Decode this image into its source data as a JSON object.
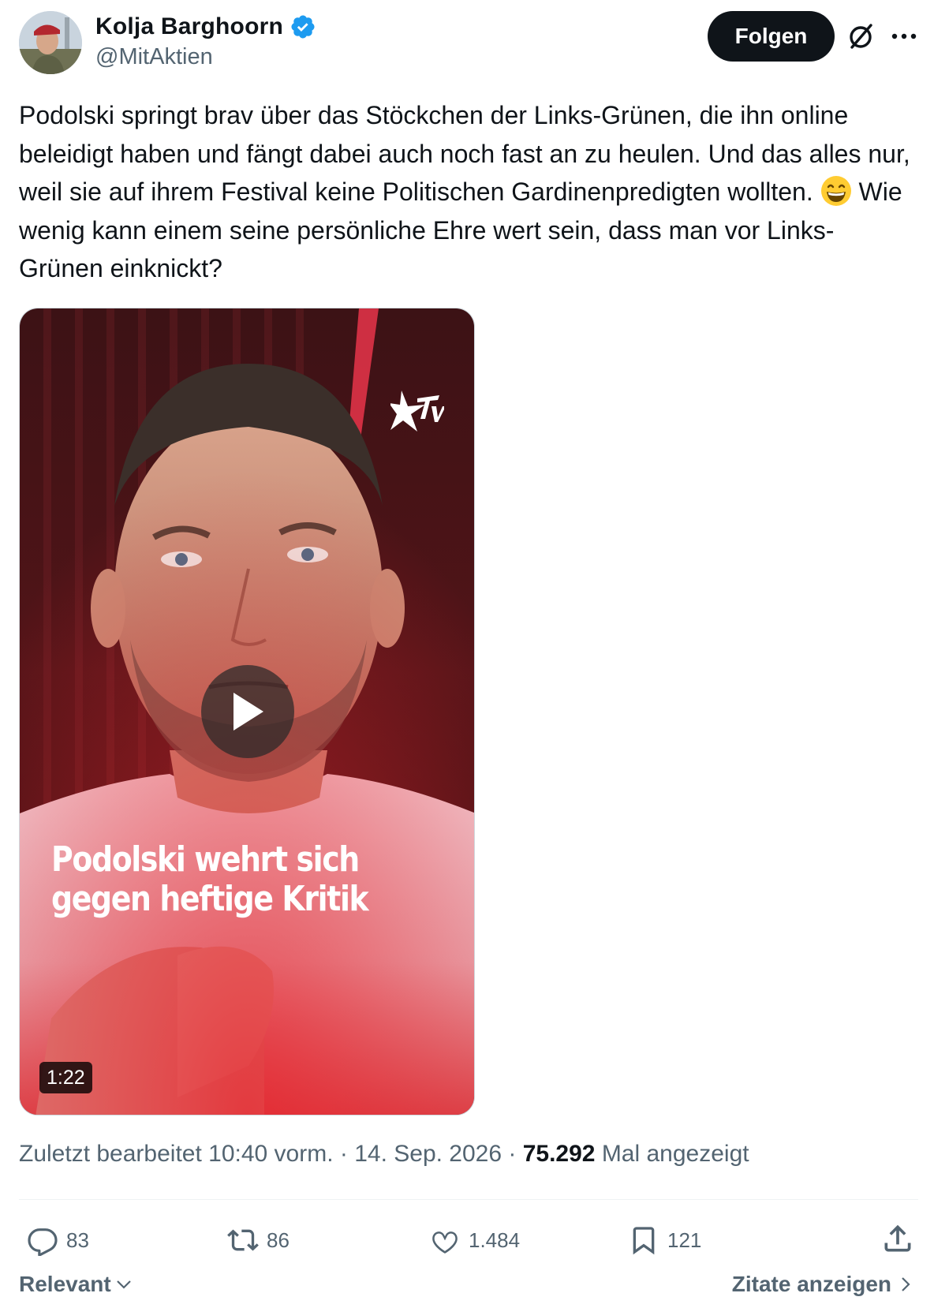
{
  "author": {
    "name": "Kolja Barghoorn",
    "handle": "@MitAktien",
    "verified": true
  },
  "header": {
    "follow_label": "Folgen",
    "icons": [
      "grok-icon",
      "more-icon"
    ]
  },
  "tweet": {
    "text_before_emoji": "Podolski springt brav über das Stöckchen der Links-Grünen, die ihn online beleidigt haben und fängt dabei auch noch fast an zu heulen. Und das alles nur, weil sie auf ihrem Festival keine Politischen Gardinenpredigten wollten. ",
    "emoji": "grinning-face-with-smiling-eyes",
    "text_after_emoji": " Wie wenig kann einem seine persönliche Ehre wert sein, dass man vor Links-Grünen einknickt?"
  },
  "video": {
    "caption_line1": "Podolski wehrt sich",
    "caption_line2": "gegen heftige Kritik",
    "duration": "1:22",
    "logo": "stern-tv-logo"
  },
  "meta": {
    "edited_label": "Zuletzt bearbeitet 10:40 vorm.",
    "separator": " · ",
    "date": "14. Sep. 2026",
    "views_count": "75.292",
    "views_label": " Mal angezeigt"
  },
  "actions": {
    "replies": "83",
    "reposts": "86",
    "likes": "1.484",
    "bookmarks": "121"
  },
  "footer": {
    "sort_label": "Relevant",
    "quotes_label": "Zitate anzeigen"
  },
  "colors": {
    "text": "#0f1419",
    "secondary": "#536471",
    "verified": "#1d9bf0",
    "divider": "#eff3f4"
  }
}
